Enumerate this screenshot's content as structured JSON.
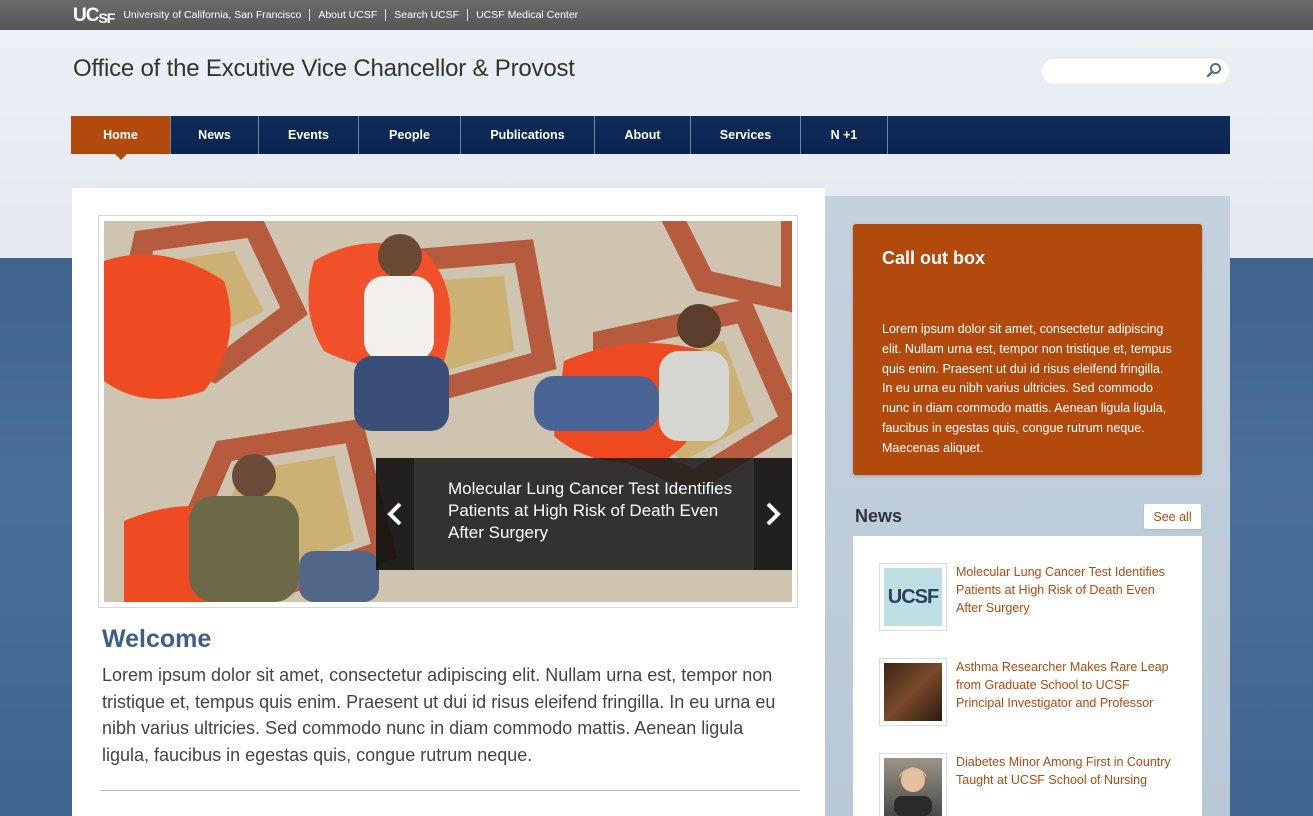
{
  "utility": {
    "logo": "UCSF",
    "links": [
      "University of California, San Francisco",
      "About UCSF",
      "Search UCSF",
      "UCSF Medical Center"
    ]
  },
  "header": {
    "title": "Office of the Excutive Vice Chancellor & Provost",
    "search_placeholder": ""
  },
  "nav": {
    "items": [
      "Home",
      "News",
      "Events",
      "People",
      "Publications",
      "About",
      "Services",
      "N +1"
    ],
    "active": "Home"
  },
  "slider": {
    "caption": "Molecular Lung Cancer Test Identifies Patients at High Risk of Death Even After Surgery"
  },
  "welcome": {
    "title": "Welcome",
    "text": "Lorem ipsum dolor sit amet, consectetur adipiscing elit. Nullam urna est, tempor non tristique et, tempus quis enim. Praesent ut dui id risus eleifend fringilla. In eu urna eu nibh varius ultricies. Sed commodo nunc in diam commodo mattis. Aenean ligula ligula, faucibus in egestas quis, congue rutrum neque."
  },
  "callout": {
    "title": "Call out box",
    "text": "Lorem ipsum dolor sit amet, consectetur adipiscing elit. Nullam urna est, tempor non tristique et, tempus quis enim. Praesent ut dui id risus eleifend fringilla. In eu urna eu nibh varius ultricies. Sed commodo nunc in diam commodo mattis. Aenean ligula ligula, faucibus in egestas quis, congue rutrum neque. Maecenas aliquet."
  },
  "news": {
    "heading": "News",
    "see_all": "See all",
    "items": [
      {
        "title": "Molecular Lung Cancer Test Identifies Patients at High Risk of Death Even After Surgery",
        "thumb_logo": "UCSF"
      },
      {
        "title": "Asthma Researcher Makes Rare Leap from Graduate School to UCSF Principal Investigator and Professor"
      },
      {
        "title": "Diabetes Minor Among First in Country Taught at UCSF School of Nursing"
      }
    ]
  },
  "colors": {
    "accent": "#b2490d",
    "nav_bg": "#0e2c5a",
    "heading_blue": "#3b5f89",
    "page_blue": "#43678f"
  }
}
